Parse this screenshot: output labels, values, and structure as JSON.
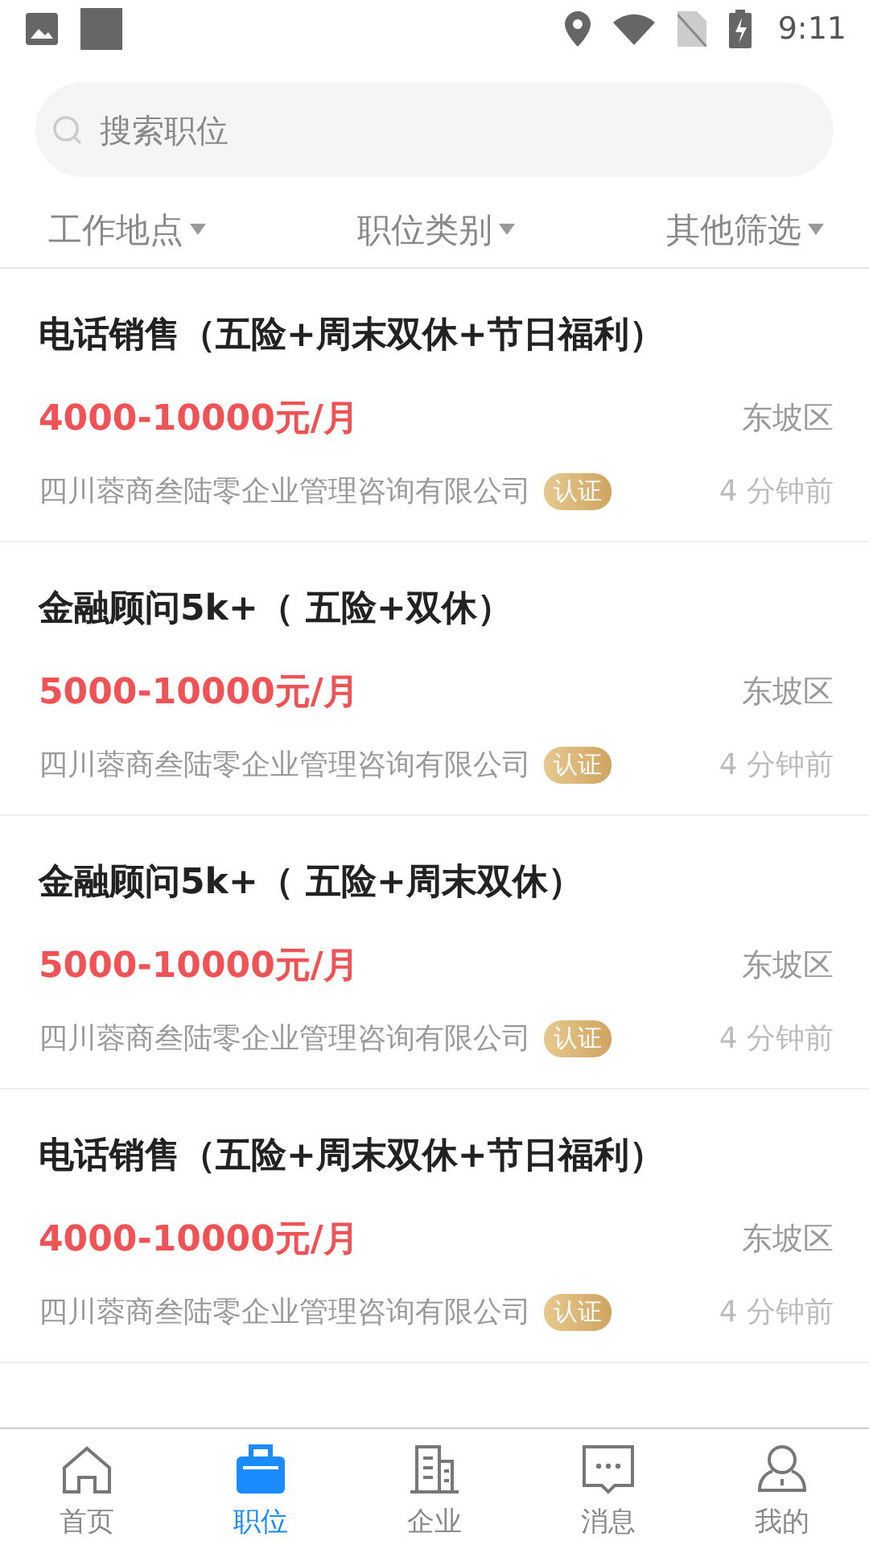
{
  "status_bar": {
    "time": "9:11"
  },
  "search": {
    "placeholder": "搜索职位"
  },
  "filters": [
    {
      "label": "工作地点"
    },
    {
      "label": "职位类别"
    },
    {
      "label": "其他筛选"
    }
  ],
  "jobs": [
    {
      "title": "电话销售（五险+周末双休+节日福利）",
      "salary": "4000-10000元/月",
      "district": "东坡区",
      "company": "四川蓉商叁陆零企业管理咨询有限公司",
      "verified": true,
      "badge": "认证",
      "posted": "4 分钟前"
    },
    {
      "title": "金融顾问5k+（ 五险+双休）",
      "salary": "5000-10000元/月",
      "district": "东坡区",
      "company": "四川蓉商叁陆零企业管理咨询有限公司",
      "verified": true,
      "badge": "认证",
      "posted": "4 分钟前"
    },
    {
      "title": "金融顾问5k+（ 五险+周末双休）",
      "salary": "5000-10000元/月",
      "district": "东坡区",
      "company": "四川蓉商叁陆零企业管理咨询有限公司",
      "verified": true,
      "badge": "认证",
      "posted": "4 分钟前"
    },
    {
      "title": "电话销售（五险+周末双休+节日福利）",
      "salary": "4000-10000元/月",
      "district": "东坡区",
      "company": "四川蓉商叁陆零企业管理咨询有限公司",
      "verified": true,
      "badge": "认证",
      "posted": "4 分钟前"
    }
  ],
  "tabs": [
    {
      "label": "首页",
      "kind": "home",
      "selected": false
    },
    {
      "label": "职位",
      "kind": "jobs",
      "selected": true
    },
    {
      "label": "企业",
      "kind": "company",
      "selected": false
    },
    {
      "label": "消息",
      "kind": "messages",
      "selected": false
    },
    {
      "label": "我的",
      "kind": "profile",
      "selected": false
    }
  ]
}
